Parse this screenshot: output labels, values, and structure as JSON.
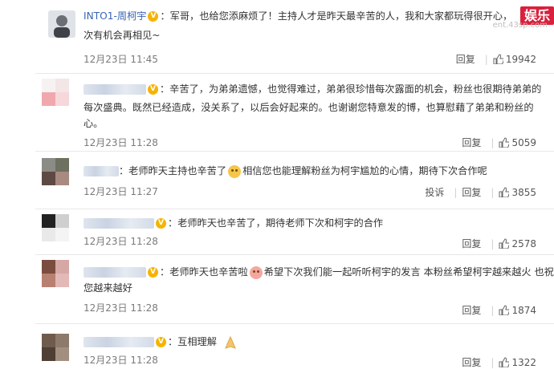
{
  "watermark": {
    "label": "娱乐",
    "url": "ent.43sp.com"
  },
  "colors": {
    "username": "#3a64b3",
    "badge": "#f5b400",
    "watermark": "#d9203c"
  },
  "comments": [
    {
      "author": "INTO1-周柯宇",
      "text": "：军哥，也给您添麻烦了！主持人才是昨天最辛苦的人，我和大家都玩得很开心，",
      "text2": "次有机会再相见~",
      "time": "12月23日 11:45",
      "reply": "回复",
      "likes": "19942"
    },
    {
      "author": "",
      "text": "：辛苦了，为弟弟遗憾，也觉得难过，弟弟很珍惜每次露面的机会，粉丝也很期待弟弟的",
      "text2": "每次盛典。既然已经造成，没关系了，以后会好起来的。也谢谢您特意发的博，也算慰藉了弟弟和粉丝的",
      "text3": "心。",
      "time": "12月23日 11:28",
      "reply": "回复",
      "likes": "5059"
    },
    {
      "author": "",
      "text_a": "：老师昨天主持也辛苦了",
      "text_b": "相信您也能理解粉丝为柯宇尴尬的心情，期待下次合作呢",
      "time": "12月23日 11:27",
      "report": "投诉",
      "reply": "回复",
      "likes": "3855"
    },
    {
      "author": "",
      "text": "：老师昨天也辛苦了，期待老师下次和柯宇的合作",
      "time": "12月23日 11:28",
      "reply": "回复",
      "likes": "2578"
    },
    {
      "author": "",
      "text_a": "：老师昨天也辛苦啦",
      "text_b": "希望下次我们能一起听听柯宇的发言 本粉丝希望柯宇越来越火 也祝",
      "text2": "您越来越好",
      "time": "12月23日 11:28",
      "reply": "回复",
      "likes": "1874"
    },
    {
      "author": "",
      "text": "：互相理解",
      "time": "12月23日 11:28",
      "reply": "回复",
      "likes": "1322"
    }
  ]
}
